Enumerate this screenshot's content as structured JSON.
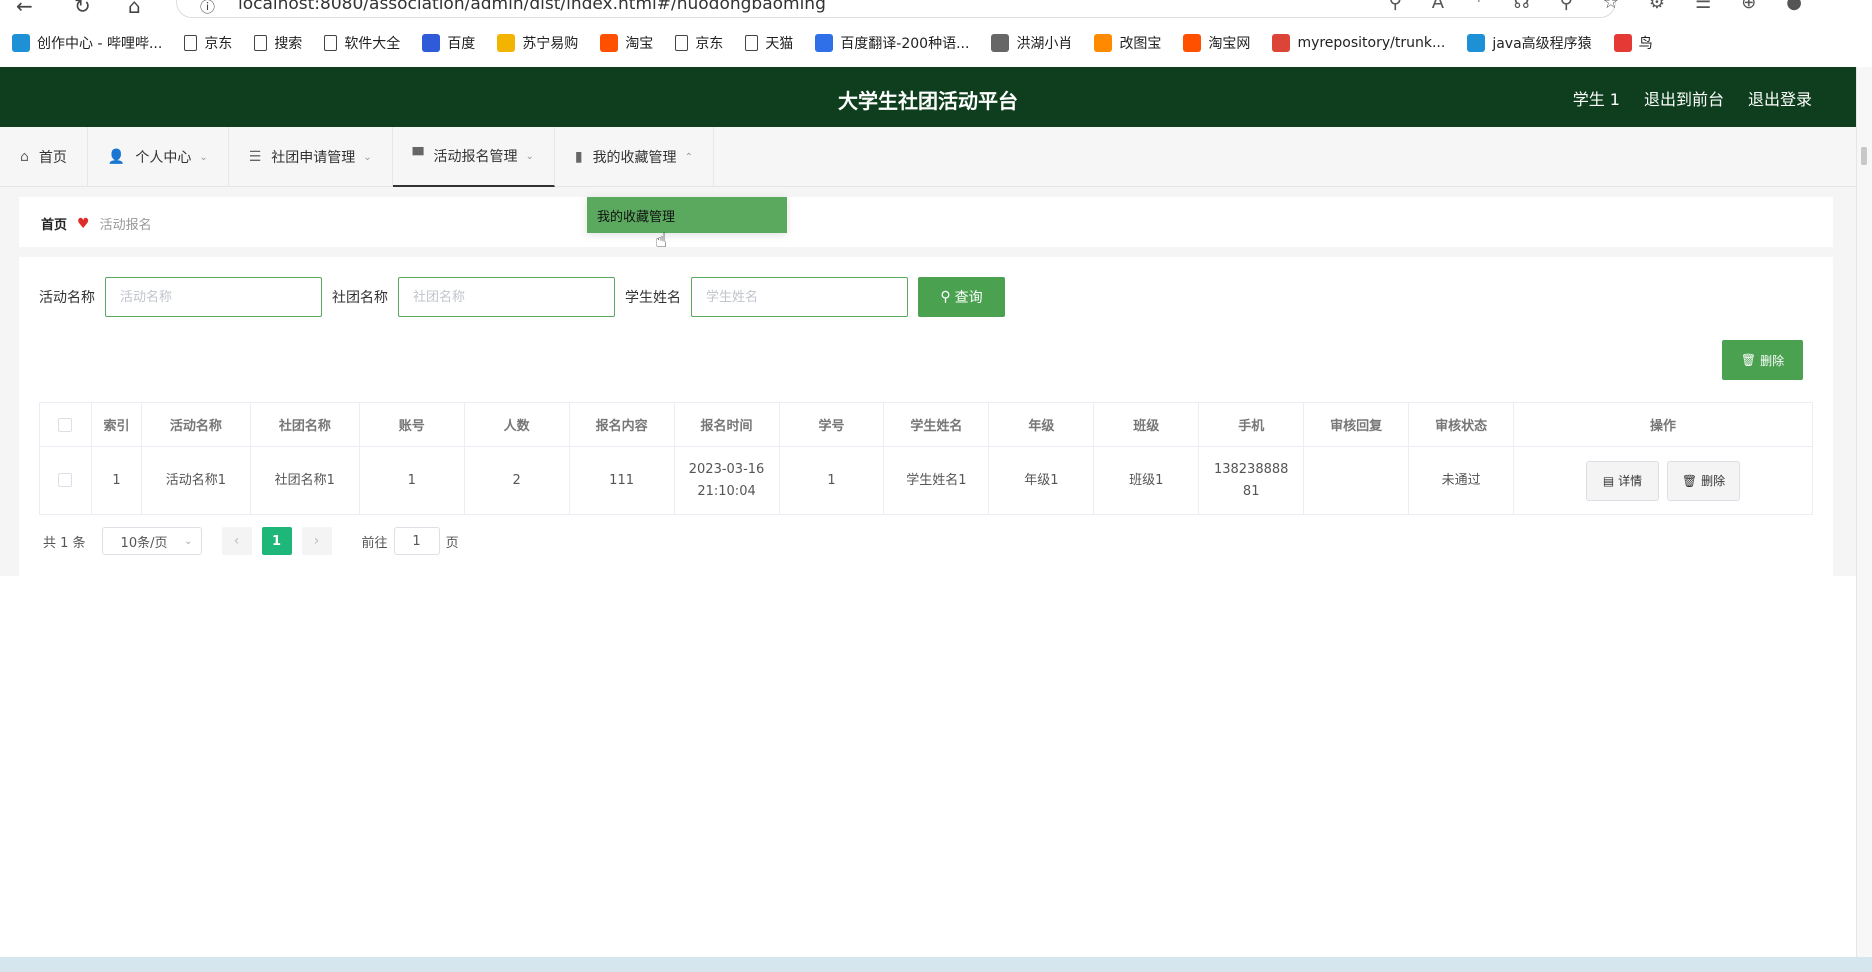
{
  "browser": {
    "url": "localhost:8080/association/admin/dist/index.html#/huodongbaoming",
    "bookmarks": [
      {
        "label": "创作中心 - 哔哩哔...",
        "icon": "bilibili-icon",
        "color": "#1e90d6"
      },
      {
        "label": "京东",
        "icon": "file-icon"
      },
      {
        "label": "搜索",
        "icon": "file-icon"
      },
      {
        "label": "软件大全",
        "icon": "file-icon"
      },
      {
        "label": "百度",
        "icon": "baidu-paw-icon",
        "color": "#2f5bd8"
      },
      {
        "label": "苏宁易购",
        "icon": "suning-icon",
        "color": "#f3b400"
      },
      {
        "label": "淘宝",
        "icon": "taobao-icon",
        "color": "#ff5000"
      },
      {
        "label": "京东",
        "icon": "file-icon"
      },
      {
        "label": "天猫",
        "icon": "file-icon"
      },
      {
        "label": "百度翻译-200种语...",
        "icon": "translate-icon",
        "color": "#2f6fe8"
      },
      {
        "label": "洪湖小肖",
        "icon": "bird-icon",
        "color": "#666666"
      },
      {
        "label": "改图宝",
        "icon": "gaitubao-icon",
        "color": "#ff8a00"
      },
      {
        "label": "淘宝网",
        "icon": "taobao-icon",
        "color": "#ff5000"
      },
      {
        "label": "myrepository/trunk...",
        "icon": "chrome-icon",
        "color": "#db4437"
      },
      {
        "label": "java高级程序猿",
        "icon": "bilibili-icon",
        "color": "#1e90d6"
      },
      {
        "label": "鸟",
        "icon": "bird-red-icon",
        "color": "#e53935"
      }
    ]
  },
  "header": {
    "title": "大学生社团活动平台",
    "links": [
      "学生 1",
      "退出到前台",
      "退出登录"
    ]
  },
  "menu": {
    "items": [
      {
        "label": "首页",
        "icon": "home-icon",
        "glyph": "⌂",
        "chevron": ""
      },
      {
        "label": "个人中心",
        "icon": "user-icon",
        "glyph": "👤",
        "chevron": "⌄"
      },
      {
        "label": "社团申请管理",
        "icon": "list-icon",
        "glyph": "☰",
        "chevron": "⌄"
      },
      {
        "label": "活动报名管理",
        "icon": "monitor-icon",
        "glyph": "▀",
        "chevron": "⌄"
      },
      {
        "label": "我的收藏管理",
        "icon": "chart-icon",
        "glyph": "▮",
        "chevron": "⌃"
      }
    ],
    "dropdown_item": "我的收藏管理"
  },
  "breadcrumb": {
    "home": "首页",
    "current": "活动报名"
  },
  "search": {
    "fields": [
      {
        "label": "活动名称",
        "placeholder": "活动名称"
      },
      {
        "label": "社团名称",
        "placeholder": "社团名称"
      },
      {
        "label": "学生姓名",
        "placeholder": "学生姓名"
      }
    ],
    "button": "查询"
  },
  "actions": {
    "delete": "删除"
  },
  "table": {
    "headers": [
      "索引",
      "活动名称",
      "社团名称",
      "账号",
      "人数",
      "报名内容",
      "报名时间",
      "学号",
      "学生姓名",
      "年级",
      "班级",
      "手机",
      "审核回复",
      "审核状态",
      "操作"
    ],
    "rows": [
      {
        "cells": [
          "1",
          "活动名称1",
          "社团名称1",
          "1",
          "2",
          "111",
          "2023-03-16 21:10:04",
          "1",
          "学生姓名1",
          "年级1",
          "班级1",
          "13823888881",
          "",
          "未通过"
        ],
        "actions": [
          "详情",
          "删除"
        ]
      }
    ]
  },
  "pagination": {
    "total": "共 1 条",
    "page_size": "10条/页",
    "current": "1",
    "goto_prefix": "前往",
    "goto_value": "1",
    "goto_suffix": "页"
  },
  "colors": {
    "header_bg": "#0e3e1d",
    "accent_green": "#4aa150",
    "page_active": "#1fb67a"
  }
}
